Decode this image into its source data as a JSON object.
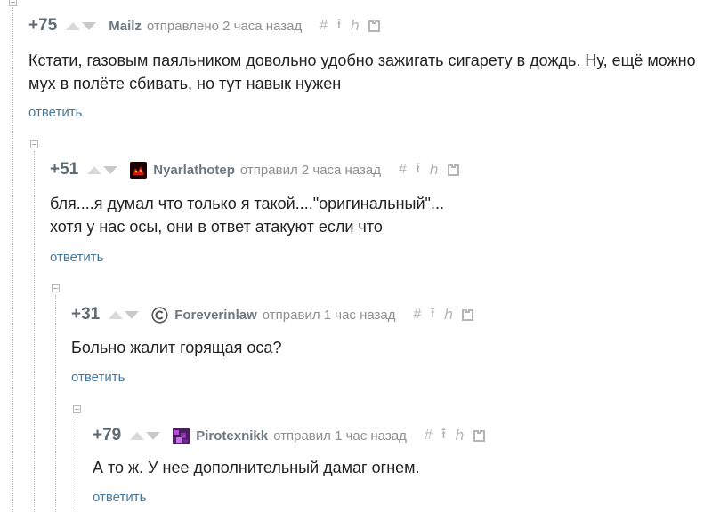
{
  "comments": [
    {
      "score": "+75",
      "author": "Mailz",
      "meta": "отправлено 2 часа назад",
      "text": "Кстати, газовым паяльником довольно удобно зажигать сигарету в дождь. Ну, ещё можно мух в полёте сбивать, но тут навык нужен",
      "reply": "ответить",
      "avatar": null
    },
    {
      "score": "+51",
      "author": "Nyarlathotep",
      "meta": "отправил 2 часа назад",
      "text": "бля....я думал что только я такой....\"оригинальный\"...\nхотя у нас осы, они в ответ атакуют если что",
      "reply": "ответить",
      "avatar": "red-creature-avatar"
    },
    {
      "score": "+31",
      "author": "Foreverinlaw",
      "meta": "отправил 1 час назад",
      "text": "Больно жалит горящая оса?",
      "reply": "ответить",
      "avatar": "copyright-avatar"
    },
    {
      "score": "+79",
      "author": "Pirotexnikk",
      "meta": "отправил 1 час назад",
      "text": "А то ж. У нее дополнительный дамаг огнем.",
      "reply": "ответить",
      "avatar": "purple-pixel-avatar"
    }
  ],
  "action_icons": [
    "hash-icon",
    "arrow-up-icon",
    "parent-link-icon",
    "save-icon"
  ],
  "colors": {
    "reply_link": "#48799d",
    "author": "#6d7880",
    "meta": "#8f8f8f",
    "score": "#5f6b73"
  }
}
